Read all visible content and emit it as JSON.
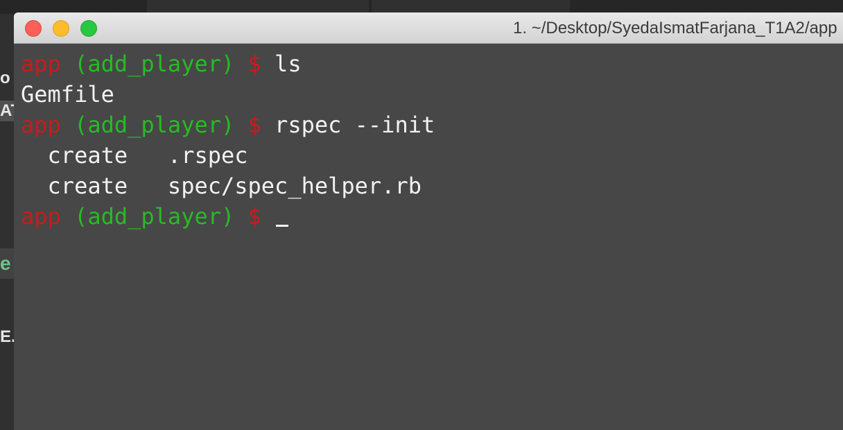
{
  "background": {
    "left_fragments": [
      "o",
      "AT",
      "e",
      "E."
    ]
  },
  "window": {
    "title": "1. ~/Desktop/SyedaIsmatFarjana_T1A2/app",
    "buttons": {
      "close": "close",
      "minimize": "minimize",
      "maximize": "zoom"
    }
  },
  "prompt": {
    "dir": "app",
    "branch": "(add_player)",
    "symbol": "$"
  },
  "lines": [
    {
      "type": "prompt",
      "command": "ls"
    },
    {
      "type": "output",
      "text": "Gemfile"
    },
    {
      "type": "prompt",
      "command": "rspec --init"
    },
    {
      "type": "output",
      "text": "  create   .rspec"
    },
    {
      "type": "output",
      "text": "  create   spec/spec_helper.rb"
    },
    {
      "type": "prompt",
      "command": ""
    }
  ],
  "colors": {
    "prompt_dir": "#c91b1b",
    "prompt_branch": "#25bc24",
    "terminal_bg": "#474747",
    "text": "#f2f2f2"
  }
}
